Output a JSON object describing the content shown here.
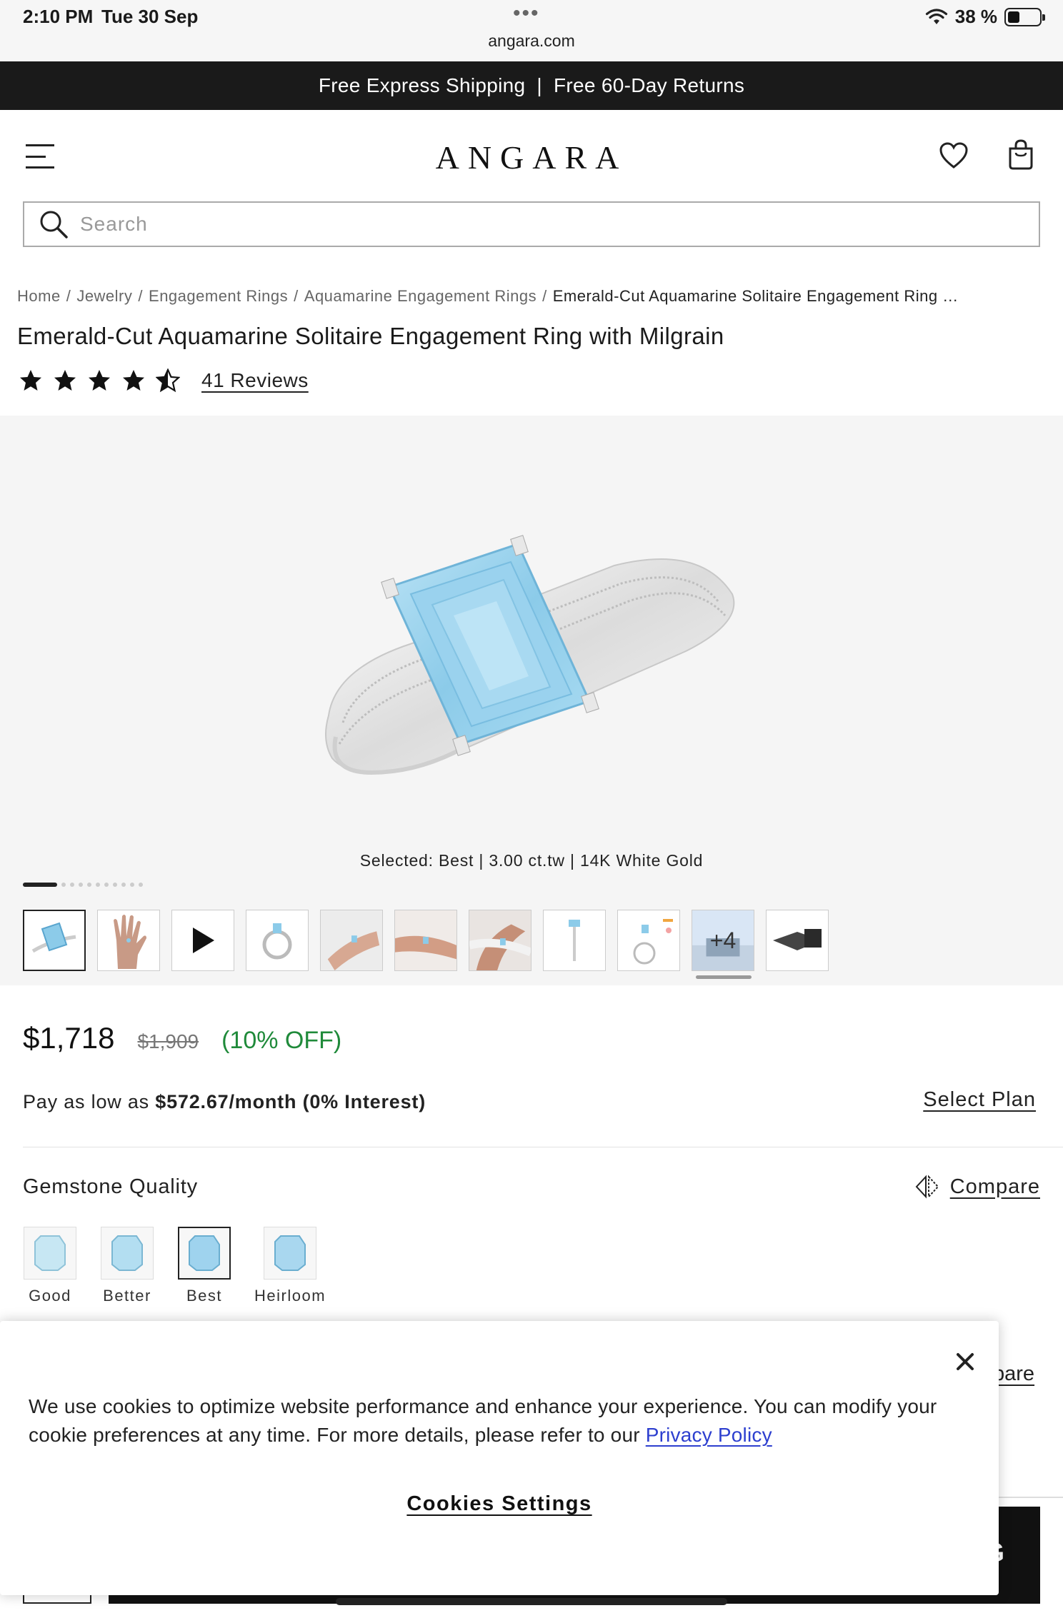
{
  "status_bar": {
    "time": "2:10 PM",
    "date": "Tue 30 Sep",
    "dots": "•••",
    "url": "angara.com",
    "battery": "38 %",
    "battery_level": 0.38
  },
  "promo": {
    "left": "Free Express Shipping",
    "separator": "|",
    "right": "Free 60-Day Returns"
  },
  "header": {
    "logo": "ANGARA"
  },
  "search": {
    "placeholder": "Search"
  },
  "breadcrumb": {
    "items": [
      "Home",
      "Jewelry",
      "Engagement Rings",
      "Aquamarine Engagement Rings"
    ],
    "separator": "/",
    "current": "Emerald-Cut Aquamarine Solitaire Engagement Ring …"
  },
  "product": {
    "title": "Emerald-Cut Aquamarine Solitaire Engagement Ring with Milgrain",
    "rating": 4.5,
    "reviews_label": "41 Reviews",
    "selected_caption": "Selected: Best | 3.00 ct.tw | 14K White Gold",
    "thumbnails_more_label": "+4",
    "price": "$1,718",
    "price_original": "$1,909",
    "discount": "(10% OFF)",
    "emi_prefix": "Pay as low as ",
    "emi_amount": "$572.67/month",
    "emi_suffix": " (0% Interest)",
    "select_plan": "Select Plan"
  },
  "gemstone_quality": {
    "title": "Gemstone Quality",
    "compare_label": "Compare",
    "options": [
      "Good",
      "Better",
      "Best",
      "Heirloom"
    ],
    "selected": "Best"
  },
  "behind_modal": {
    "compare_fragment": "pare",
    "button_fragment": "G"
  },
  "cookie_banner": {
    "text": "We use cookies to optimize website performance and enhance your experience. You can modify your cookie preferences at any time. For more details, please refer to our ",
    "link": "Privacy Policy",
    "settings_button": "Cookies Settings"
  },
  "colors": {
    "promo_bg": "#1a1a1a",
    "discount_green": "#1f8a3a",
    "link_blue": "#2d3fcf",
    "gem_blue": "#9fd3ee"
  }
}
